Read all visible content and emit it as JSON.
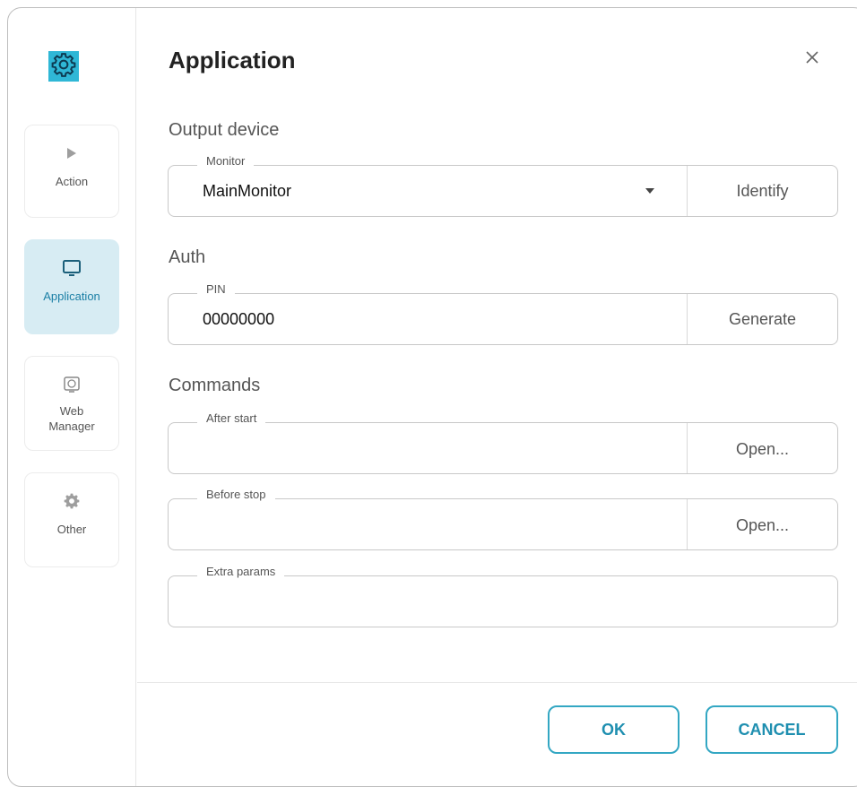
{
  "sidebar": {
    "logo_icon": "gear-icon",
    "items": [
      {
        "label": "Action",
        "icon": "play-icon",
        "active": false
      },
      {
        "label": "Application",
        "icon": "monitor-icon",
        "active": true
      },
      {
        "label": "Web\nManager",
        "icon": "web-manager-icon",
        "active": false
      },
      {
        "label": "Other",
        "icon": "gear-icon",
        "active": false
      }
    ]
  },
  "dialog": {
    "title": "Application",
    "close_icon": "close-icon"
  },
  "output_device": {
    "section_label": "Output device",
    "monitor_legend": "Monitor",
    "monitor_value": "MainMonitor",
    "identify_label": "Identify"
  },
  "auth": {
    "section_label": "Auth",
    "pin_legend": "PIN",
    "pin_value": "00000000",
    "generate_label": "Generate"
  },
  "commands": {
    "section_label": "Commands",
    "after_start_legend": "After start",
    "after_start_value": "",
    "after_start_button": "Open...",
    "before_stop_legend": "Before stop",
    "before_stop_value": "",
    "before_stop_button": "Open...",
    "extra_params_legend": "Extra params",
    "extra_params_value": ""
  },
  "footer": {
    "ok_label": "OK",
    "cancel_label": "CANCEL"
  },
  "colors": {
    "accent": "#33a7c3",
    "active_bg": "#d7ecf3",
    "logo_bg": "#2fb7d6"
  }
}
